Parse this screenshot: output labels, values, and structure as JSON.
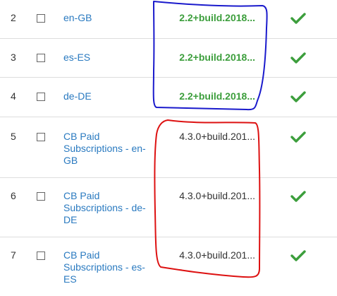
{
  "rows": [
    {
      "num": "2",
      "name": "en-GB",
      "version": "2.2+build.2018..."
    },
    {
      "num": "3",
      "name": "es-ES",
      "version": "2.2+build.2018..."
    },
    {
      "num": "4",
      "name": "de-DE",
      "version": "2.2+build.2018..."
    },
    {
      "num": "5",
      "name": "CB Paid Subscriptions - en-GB",
      "version": "4.3.0+build.201..."
    },
    {
      "num": "6",
      "name": "CB Paid Subscriptions - de-DE",
      "version": "4.3.0+build.201..."
    },
    {
      "num": "7",
      "name": "CB Paid Subscriptions - es-ES",
      "version": "4.3.0+build.201..."
    }
  ],
  "colors": {
    "link": "#2a7ac0",
    "version_green": "#3c9e3c",
    "check_green": "#3c9e3c",
    "annotation_blue": "#1a1acc",
    "annotation_red": "#dd1111"
  },
  "icons": {
    "status": "checkmark-icon",
    "select": "checkbox"
  }
}
